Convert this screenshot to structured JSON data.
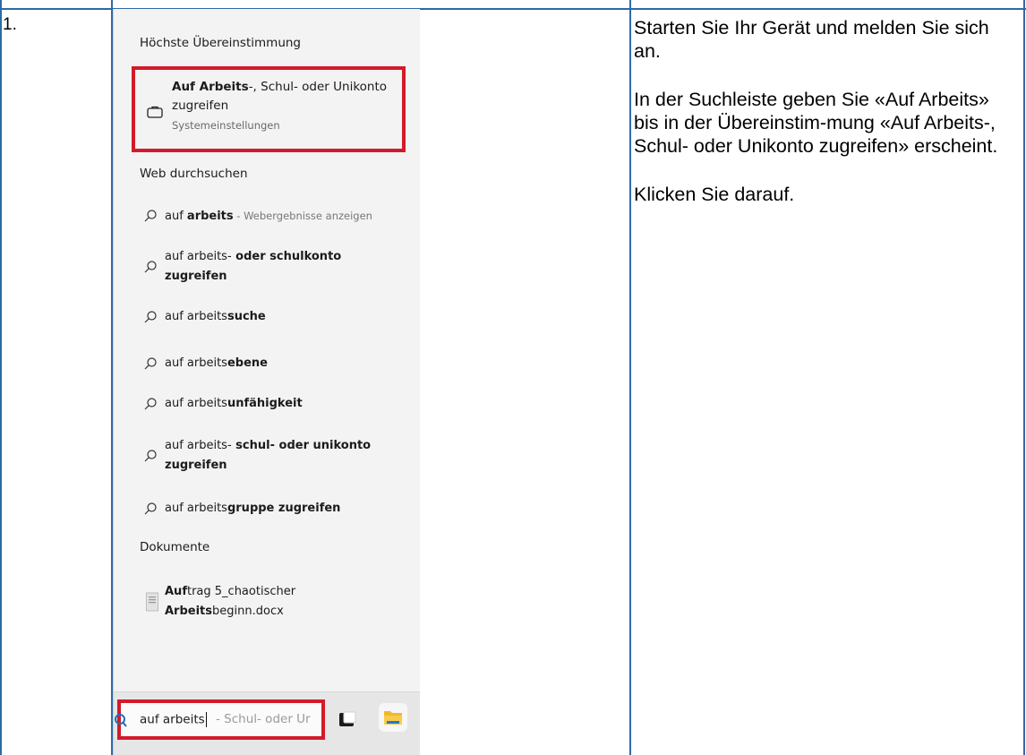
{
  "step": "1.",
  "instructions": [
    "Starten Sie Ihr Gerät und melden Sie sich an.",
    "In der Suchleiste geben Sie «Auf Arbeits» bis in der Übereinstim-mung «Auf Arbeits-, Schul- oder Unikonto zugreifen» erscheint.",
    "Klicken Sie darauf."
  ],
  "screenshot": {
    "best_match_heading": "Höchste Übereinstimmung",
    "best_match": {
      "title_bold": "Auf Arbeits",
      "title_rest": "-, Schul- oder Unikonto",
      "title_line2": "zugreifen",
      "subtitle": "Systemeinstellungen",
      "icon": "briefcase-icon"
    },
    "web_heading": "Web durchsuchen",
    "web_results": [
      {
        "plain": "auf ",
        "bold": "arbeits",
        "hint": " - Webergebnisse anzeigen",
        "line2": ""
      },
      {
        "plain": "auf arbeits-",
        "bold": " oder schulkonto",
        "hint": "",
        "line2": "zugreifen"
      },
      {
        "plain": "auf arbeits",
        "bold": "suche",
        "hint": "",
        "line2": ""
      },
      {
        "plain": "auf arbeits",
        "bold": "ebene",
        "hint": "",
        "line2": ""
      },
      {
        "plain": "auf arbeits",
        "bold": "unfähigkeit",
        "hint": "",
        "line2": ""
      },
      {
        "plain": "auf arbeits-",
        "bold": " schul- oder unikonto",
        "hint": "",
        "line2": "zugreifen"
      },
      {
        "plain": "auf arbeits",
        "bold": "gruppe zugreifen",
        "hint": "",
        "line2": ""
      }
    ],
    "docs_heading": "Dokumente",
    "document": {
      "bold1": "Auf",
      "rest1": "trag 5_chaotischer",
      "bold2": "Arbeits",
      "rest2": "beginn.docx"
    },
    "search_box": {
      "value": "auf arbeits",
      "suggestion": "- Schul- oder Ur"
    },
    "colors": {
      "highlight": "#d21b2a",
      "table_border": "#2e6aa6"
    }
  }
}
